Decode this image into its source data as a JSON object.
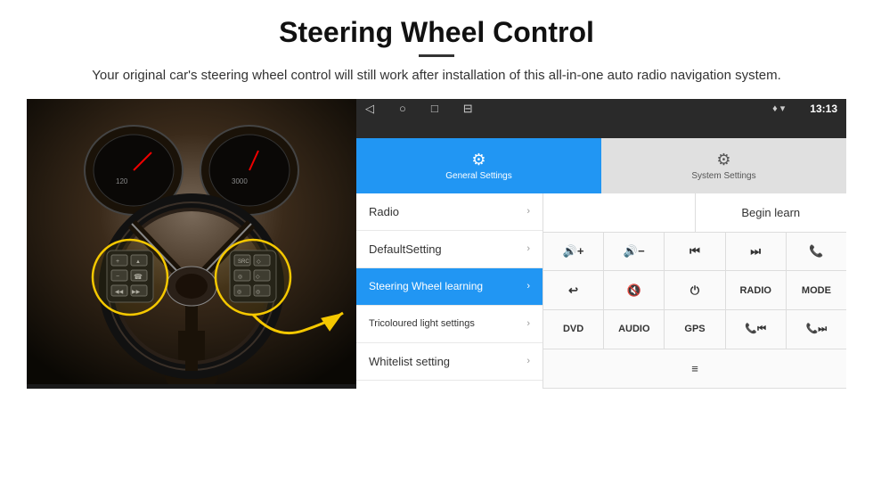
{
  "header": {
    "title": "Steering Wheel Control",
    "divider": true,
    "subtitle": "Your original car's steering wheel control will still work after installation of this all-in-one auto radio navigation system."
  },
  "statusBar": {
    "navIcons": [
      "◁",
      "○",
      "□",
      "⊟"
    ],
    "rightIcons": "♦ ▾",
    "time": "13:13"
  },
  "tabs": [
    {
      "id": "general",
      "label": "General Settings",
      "icon": "⚙",
      "active": true
    },
    {
      "id": "system",
      "label": "System Settings",
      "icon": "⚙",
      "active": false
    }
  ],
  "menuItems": [
    {
      "label": "Radio",
      "active": false
    },
    {
      "label": "DefaultSetting",
      "active": false
    },
    {
      "label": "Steering Wheel learning",
      "active": true
    },
    {
      "label": "Tricoloured light settings",
      "active": false
    },
    {
      "label": "Whitelist setting",
      "active": false
    }
  ],
  "controlPanel": {
    "beginLearn": "Begin learn",
    "row1": [
      "🔊+",
      "🔊−",
      "⏮",
      "⏭",
      "📞"
    ],
    "row2": [
      "↩",
      "🔊✕",
      "⏻",
      "RADIO",
      "MODE"
    ],
    "row3": [
      "DVD",
      "AUDIO",
      "GPS",
      "📞⏮",
      "📞⏭"
    ],
    "row4Icon": "≡"
  },
  "colors": {
    "activeBlue": "#2196f3",
    "statusBarBg": "#2a2a2a",
    "menuBg": "#fff",
    "activeMenuBg": "#2196f3"
  }
}
